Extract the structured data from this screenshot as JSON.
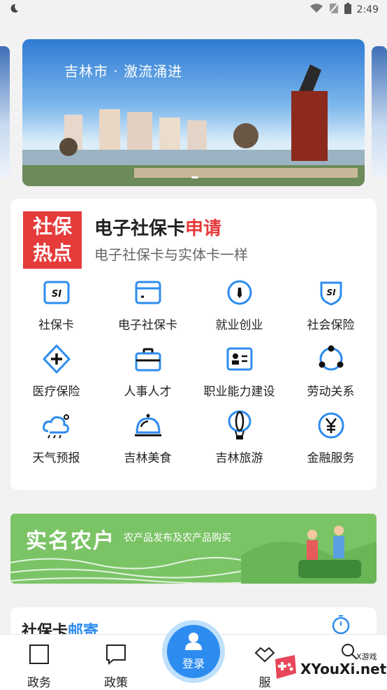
{
  "status": {
    "time": "2:49"
  },
  "banner": {
    "caption": "吉林市 · 激流涌进"
  },
  "hot": {
    "logo_line1": "社保",
    "logo_line2": "热点",
    "title_main": "电子社保卡",
    "title_accent": "申请",
    "subtitle": "电子社保卡与实体卡一样"
  },
  "services": [
    {
      "label": "社保卡",
      "icon": "si-card-icon"
    },
    {
      "label": "电子社保卡",
      "icon": "e-card-icon"
    },
    {
      "label": "就业创业",
      "icon": "employment-icon"
    },
    {
      "label": "社会保险",
      "icon": "insurance-shield-icon"
    },
    {
      "label": "医疗保险",
      "icon": "medical-plus-icon"
    },
    {
      "label": "人事人才",
      "icon": "briefcase-icon"
    },
    {
      "label": "职业能力建设",
      "icon": "training-id-icon"
    },
    {
      "label": "劳动关系",
      "icon": "relations-cycle-icon"
    },
    {
      "label": "天气预报",
      "icon": "weather-icon"
    },
    {
      "label": "吉林美食",
      "icon": "food-cloche-icon"
    },
    {
      "label": "吉林旅游",
      "icon": "travel-balloon-icon"
    },
    {
      "label": "金融服务",
      "icon": "yen-icon"
    }
  ],
  "farm": {
    "title": "实名农户",
    "subtitle": "农产品发布及农产品购买"
  },
  "mail": {
    "title_main": "社保卡",
    "title_accent": "邮寄"
  },
  "tabbar": {
    "items": [
      {
        "label": "政务",
        "icon": "gov-icon"
      },
      {
        "label": "政策",
        "icon": "policy-icon"
      },
      {
        "label": "服",
        "icon": "service-icon"
      }
    ],
    "login_label": "登录"
  },
  "watermark": {
    "text": "XYouXi.net",
    "small": "X游戏"
  },
  "colors": {
    "accent_blue": "#2d8cf0",
    "accent_red": "#e53b3b",
    "farm_green": "#7bc466"
  }
}
